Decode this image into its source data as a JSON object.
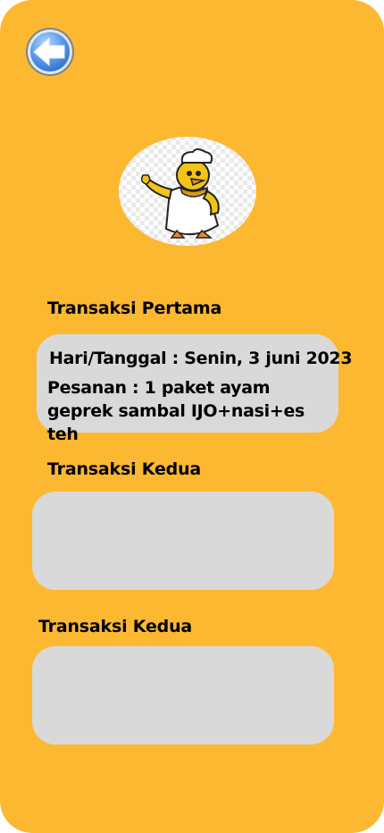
{
  "colors": {
    "background": "#FDB831",
    "card": "#D9D9D9",
    "back_button": "#5B9CE8",
    "text": "#000000"
  },
  "header": {
    "back_icon": "back-arrow-icon"
  },
  "logo": {
    "icon": "chicken-chef-mascot"
  },
  "transactions": [
    {
      "title": "Transaksi Pertama",
      "date_line": "Hari/Tanggal : Senin, 3 juni 2023",
      "order_line": "Pesanan : 1 paket ayam geprek sambal IJO+nasi+es teh"
    },
    {
      "title": "Transaksi Kedua"
    },
    {
      "title": "Transaksi Kedua"
    }
  ]
}
